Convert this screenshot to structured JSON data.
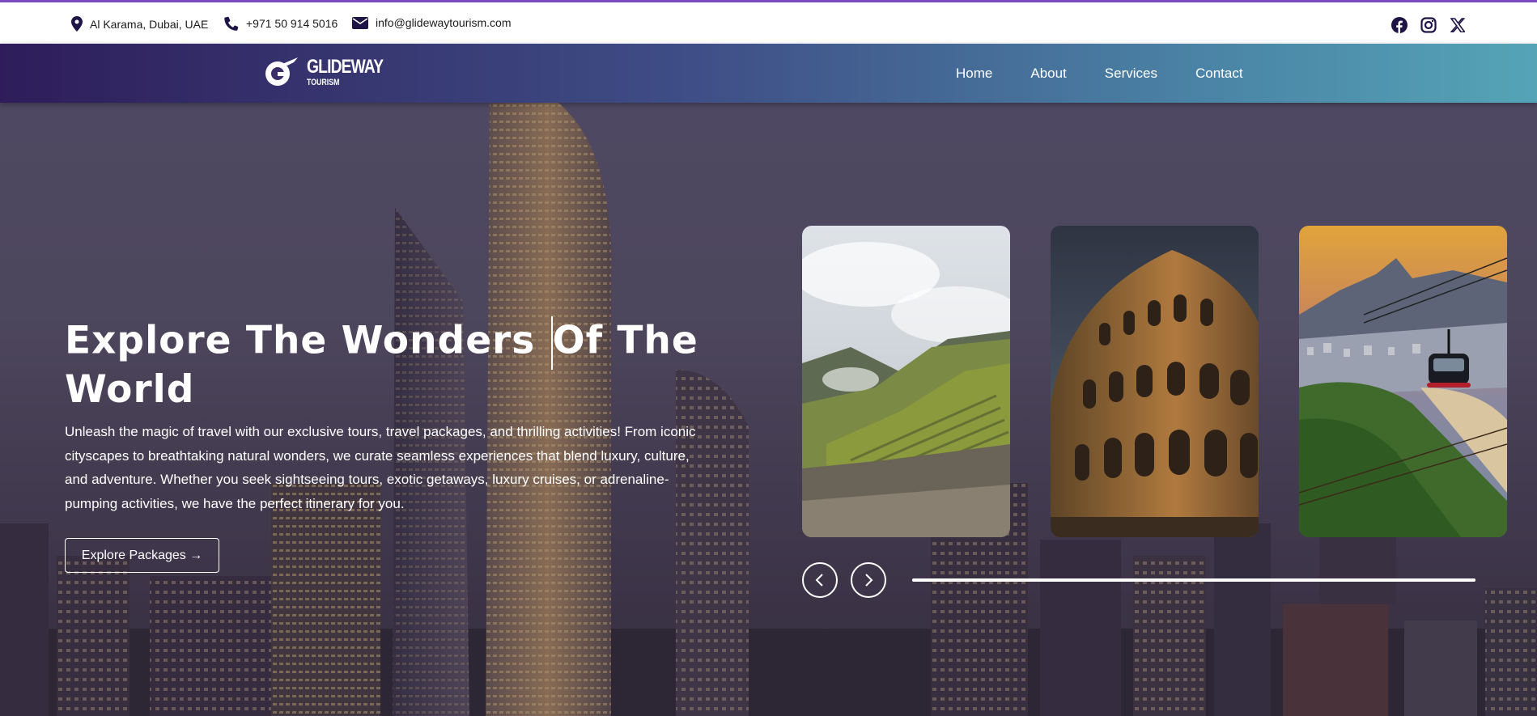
{
  "topbar": {
    "location": "Al Karama, Dubai, UAE",
    "phone": "+971 50 914 5016",
    "email": "info@glidewaytourism.com",
    "social_icons": [
      "facebook-icon",
      "instagram-icon",
      "x-icon"
    ]
  },
  "nav": {
    "logo_main": "GLIDEWAY",
    "logo_sub": "TOURISM",
    "links": [
      "Home",
      "About",
      "Services",
      "Contact"
    ]
  },
  "hero": {
    "title_part1": "Explore The Wonders ",
    "title_part2": "Of The World",
    "description": "Unleash the magic of travel with our exclusive tours, travel packages, and thrilling activities! From iconic cityscapes to breathtaking natural wonders, we curate seamless experiences that blend luxury, culture, and adventure. Whether you seek sightseeing tours, exotic getaways, luxury cruises, or adrenaline-pumping activities, we have the perfect itinerary for you.",
    "cta_label": "Explore Packages →"
  },
  "slider": {
    "cards": [
      "machu-picchu-image",
      "colosseum-image",
      "rio-cable-car-image"
    ],
    "progress_fraction": 1.0
  },
  "colors": {
    "accent": "#7a4bc0",
    "nav_start": "#2e1d5a",
    "nav_end": "#55a4b6",
    "icon_dark": "#1f1446"
  }
}
